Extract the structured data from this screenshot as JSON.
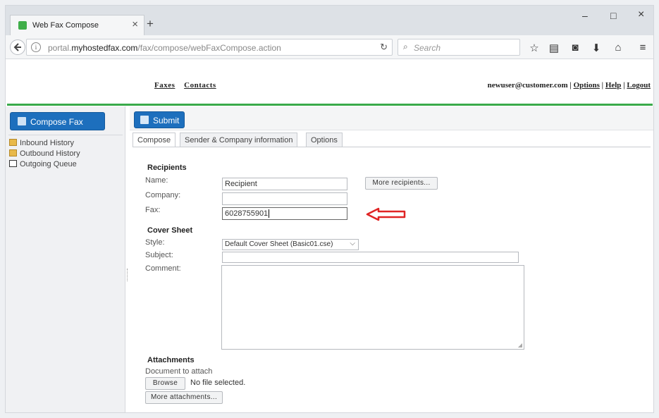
{
  "browser": {
    "tab_title": "Web Fax Compose",
    "url_prefix": "portal.",
    "url_domain": "myhostedfax.com",
    "url_path": "/fax/compose/webFaxCompose.action",
    "search_placeholder": "Search",
    "new_tab_label": "+",
    "tab_close_label": "×",
    "minimize_label": "–",
    "maximize_label": "□",
    "close_label": "×"
  },
  "topnav": {
    "faxes": "Faxes",
    "contacts": "Contacts"
  },
  "userbar": {
    "email": "newuser@customer.com",
    "options": "Options",
    "help": "Help",
    "logout": "Logout",
    "separator": "|"
  },
  "sidebar": {
    "compose_button": "Compose Fax",
    "items": [
      {
        "label": "Inbound History"
      },
      {
        "label": "Outbound History"
      },
      {
        "label": "Outgoing Queue"
      }
    ]
  },
  "toolbar": {
    "submit_label": "Submit"
  },
  "tabs": [
    {
      "label": "Compose"
    },
    {
      "label": "Sender & Company information"
    },
    {
      "label": "Options"
    }
  ],
  "recipients": {
    "title": "Recipients",
    "name_label": "Name:",
    "name_value": "Recipient",
    "company_label": "Company:",
    "company_value": "",
    "fax_label": "Fax:",
    "fax_value": "6028755901",
    "more_recipients_button": "More recipients..."
  },
  "cover_sheet": {
    "title": "Cover Sheet",
    "style_label": "Style:",
    "style_value": "Default Cover Sheet (Basic01.cse)",
    "subject_label": "Subject:",
    "subject_value": "",
    "comment_label": "Comment:"
  },
  "attachments": {
    "title": "Attachments",
    "document_label": "Document to attach",
    "browse_button": "Browse",
    "no_file_text": "No file selected.",
    "more_attachments_button": "More attachments..."
  },
  "colors": {
    "accent_blue": "#1d6fbd",
    "green_rule": "#3aaa4a",
    "annotation_arrow": "#e02424"
  }
}
